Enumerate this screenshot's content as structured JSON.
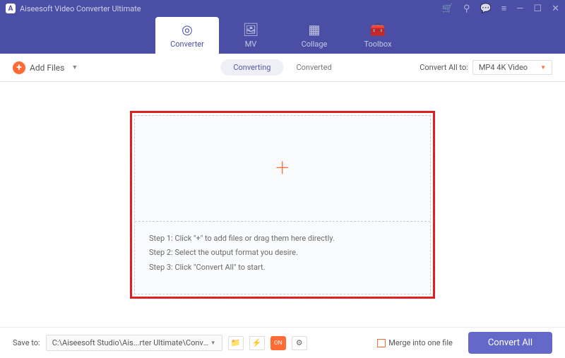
{
  "app": {
    "title": "Aiseesoft Video Converter Ultimate"
  },
  "mainTabs": [
    {
      "label": "Converter"
    },
    {
      "label": "MV"
    },
    {
      "label": "Collage"
    },
    {
      "label": "Toolbox"
    }
  ],
  "addFiles": {
    "label": "Add Files"
  },
  "subTabs": {
    "converting": "Converting",
    "converted": "Converted"
  },
  "convertAll": {
    "label": "Convert All to:",
    "format": "MP4 4K Video"
  },
  "steps": {
    "s1": "Step 1: Click \"+\" to add files or drag them here directly.",
    "s2": "Step 2: Select the output format you desire.",
    "s3": "Step 3: Click \"Convert All\" to start."
  },
  "bottom": {
    "saveToLabel": "Save to:",
    "path": "C:\\Aiseesoft Studio\\Ais...rter Ultimate\\Converted",
    "merge": "Merge into one file",
    "convertAllBtn": "Convert All"
  }
}
